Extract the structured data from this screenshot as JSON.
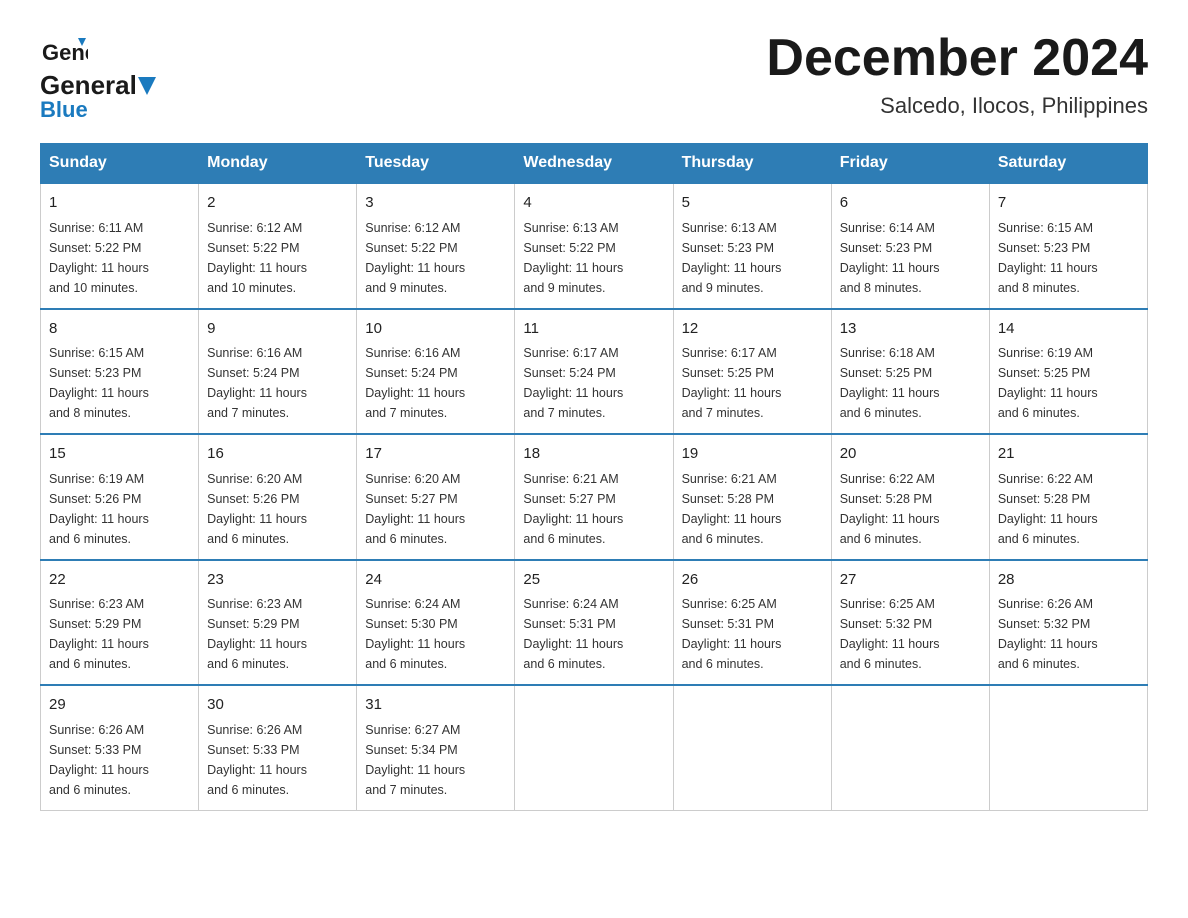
{
  "header": {
    "logo_general": "General",
    "logo_blue": "Blue",
    "month_title": "December 2024",
    "location": "Salcedo, Ilocos, Philippines"
  },
  "weekdays": [
    "Sunday",
    "Monday",
    "Tuesday",
    "Wednesday",
    "Thursday",
    "Friday",
    "Saturday"
  ],
  "weeks": [
    [
      {
        "day": "1",
        "sunrise": "6:11 AM",
        "sunset": "5:22 PM",
        "daylight": "11 hours and 10 minutes."
      },
      {
        "day": "2",
        "sunrise": "6:12 AM",
        "sunset": "5:22 PM",
        "daylight": "11 hours and 10 minutes."
      },
      {
        "day": "3",
        "sunrise": "6:12 AM",
        "sunset": "5:22 PM",
        "daylight": "11 hours and 9 minutes."
      },
      {
        "day": "4",
        "sunrise": "6:13 AM",
        "sunset": "5:22 PM",
        "daylight": "11 hours and 9 minutes."
      },
      {
        "day": "5",
        "sunrise": "6:13 AM",
        "sunset": "5:23 PM",
        "daylight": "11 hours and 9 minutes."
      },
      {
        "day": "6",
        "sunrise": "6:14 AM",
        "sunset": "5:23 PM",
        "daylight": "11 hours and 8 minutes."
      },
      {
        "day": "7",
        "sunrise": "6:15 AM",
        "sunset": "5:23 PM",
        "daylight": "11 hours and 8 minutes."
      }
    ],
    [
      {
        "day": "8",
        "sunrise": "6:15 AM",
        "sunset": "5:23 PM",
        "daylight": "11 hours and 8 minutes."
      },
      {
        "day": "9",
        "sunrise": "6:16 AM",
        "sunset": "5:24 PM",
        "daylight": "11 hours and 7 minutes."
      },
      {
        "day": "10",
        "sunrise": "6:16 AM",
        "sunset": "5:24 PM",
        "daylight": "11 hours and 7 minutes."
      },
      {
        "day": "11",
        "sunrise": "6:17 AM",
        "sunset": "5:24 PM",
        "daylight": "11 hours and 7 minutes."
      },
      {
        "day": "12",
        "sunrise": "6:17 AM",
        "sunset": "5:25 PM",
        "daylight": "11 hours and 7 minutes."
      },
      {
        "day": "13",
        "sunrise": "6:18 AM",
        "sunset": "5:25 PM",
        "daylight": "11 hours and 6 minutes."
      },
      {
        "day": "14",
        "sunrise": "6:19 AM",
        "sunset": "5:25 PM",
        "daylight": "11 hours and 6 minutes."
      }
    ],
    [
      {
        "day": "15",
        "sunrise": "6:19 AM",
        "sunset": "5:26 PM",
        "daylight": "11 hours and 6 minutes."
      },
      {
        "day": "16",
        "sunrise": "6:20 AM",
        "sunset": "5:26 PM",
        "daylight": "11 hours and 6 minutes."
      },
      {
        "day": "17",
        "sunrise": "6:20 AM",
        "sunset": "5:27 PM",
        "daylight": "11 hours and 6 minutes."
      },
      {
        "day": "18",
        "sunrise": "6:21 AM",
        "sunset": "5:27 PM",
        "daylight": "11 hours and 6 minutes."
      },
      {
        "day": "19",
        "sunrise": "6:21 AM",
        "sunset": "5:28 PM",
        "daylight": "11 hours and 6 minutes."
      },
      {
        "day": "20",
        "sunrise": "6:22 AM",
        "sunset": "5:28 PM",
        "daylight": "11 hours and 6 minutes."
      },
      {
        "day": "21",
        "sunrise": "6:22 AM",
        "sunset": "5:28 PM",
        "daylight": "11 hours and 6 minutes."
      }
    ],
    [
      {
        "day": "22",
        "sunrise": "6:23 AM",
        "sunset": "5:29 PM",
        "daylight": "11 hours and 6 minutes."
      },
      {
        "day": "23",
        "sunrise": "6:23 AM",
        "sunset": "5:29 PM",
        "daylight": "11 hours and 6 minutes."
      },
      {
        "day": "24",
        "sunrise": "6:24 AM",
        "sunset": "5:30 PM",
        "daylight": "11 hours and 6 minutes."
      },
      {
        "day": "25",
        "sunrise": "6:24 AM",
        "sunset": "5:31 PM",
        "daylight": "11 hours and 6 minutes."
      },
      {
        "day": "26",
        "sunrise": "6:25 AM",
        "sunset": "5:31 PM",
        "daylight": "11 hours and 6 minutes."
      },
      {
        "day": "27",
        "sunrise": "6:25 AM",
        "sunset": "5:32 PM",
        "daylight": "11 hours and 6 minutes."
      },
      {
        "day": "28",
        "sunrise": "6:26 AM",
        "sunset": "5:32 PM",
        "daylight": "11 hours and 6 minutes."
      }
    ],
    [
      {
        "day": "29",
        "sunrise": "6:26 AM",
        "sunset": "5:33 PM",
        "daylight": "11 hours and 6 minutes."
      },
      {
        "day": "30",
        "sunrise": "6:26 AM",
        "sunset": "5:33 PM",
        "daylight": "11 hours and 6 minutes."
      },
      {
        "day": "31",
        "sunrise": "6:27 AM",
        "sunset": "5:34 PM",
        "daylight": "11 hours and 7 minutes."
      },
      null,
      null,
      null,
      null
    ]
  ],
  "labels": {
    "sunrise": "Sunrise:",
    "sunset": "Sunset:",
    "daylight": "Daylight:"
  }
}
